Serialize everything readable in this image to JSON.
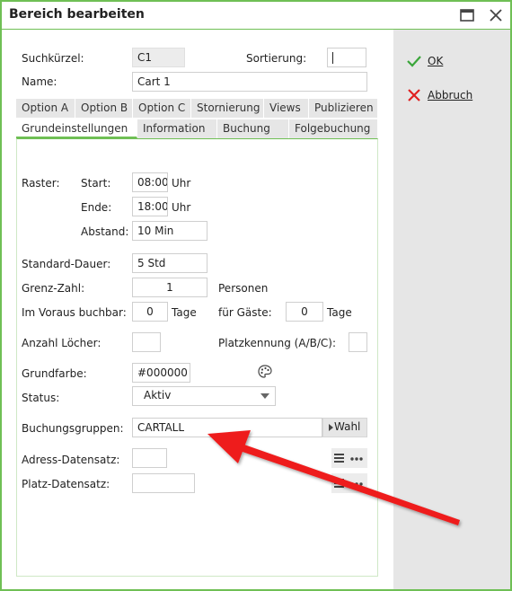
{
  "window": {
    "title": "Bereich bearbeiten",
    "maximize_icon": "maximize-icon",
    "close_icon": "close-icon"
  },
  "actions": {
    "ok_label": "OK",
    "cancel_label": "Abbruch",
    "ok_color": "#3aa63a",
    "cancel_color": "#e02020"
  },
  "header_fields": {
    "suchkuerzel_label": "Suchkürzel:",
    "suchkuerzel_value": "C1",
    "sortierung_label": "Sortierung:",
    "sortierung_value": "",
    "name_label": "Name:",
    "name_value": "Cart 1"
  },
  "tabs": {
    "row1": [
      "Option A",
      "Option B",
      "Option C",
      "Stornierung",
      "Views",
      "Publizieren"
    ],
    "row2": [
      "Grundeinstellungen",
      "Information",
      "Buchung",
      "Folgebuchung"
    ],
    "active": "Grundeinstellungen"
  },
  "form": {
    "raster_label": "Raster:",
    "start_label": "Start:",
    "start_value": "08:00",
    "start_unit": "Uhr",
    "ende_label": "Ende:",
    "ende_value": "18:00",
    "ende_unit": "Uhr",
    "abstand_label": "Abstand:",
    "abstand_value": "10 Min",
    "standard_dauer_label": "Standard-Dauer:",
    "standard_dauer_value": "5 Std",
    "grenz_zahl_label": "Grenz-Zahl:",
    "grenz_zahl_value": "1",
    "personen_label": "Personen",
    "voraus_label": "Im Voraus buchbar:",
    "voraus_value": "0",
    "voraus_unit": "Tage",
    "gaeste_label": "für Gäste:",
    "gaeste_value": "0",
    "gaeste_unit": "Tage",
    "loecher_label": "Anzahl Löcher:",
    "loecher_value": "",
    "platzkennung_label": "Platzkennung (A/B/C):",
    "platzkennung_value": "",
    "grundfarbe_label": "Grundfarbe:",
    "grundfarbe_value": "#000000",
    "status_label": "Status:",
    "status_value": "Aktiv",
    "buchungsgruppen_label": "Buchungsgruppen:",
    "buchungsgruppen_value": "CARTALL",
    "wahl_label": "Wahl",
    "adress_label": "Adress-Datensatz:",
    "adress_value": "",
    "platz_label": "Platz-Datensatz:",
    "platz_value": ""
  },
  "colors": {
    "accent_green": "#6fbf55",
    "annotation_red": "#ee1c1c"
  }
}
